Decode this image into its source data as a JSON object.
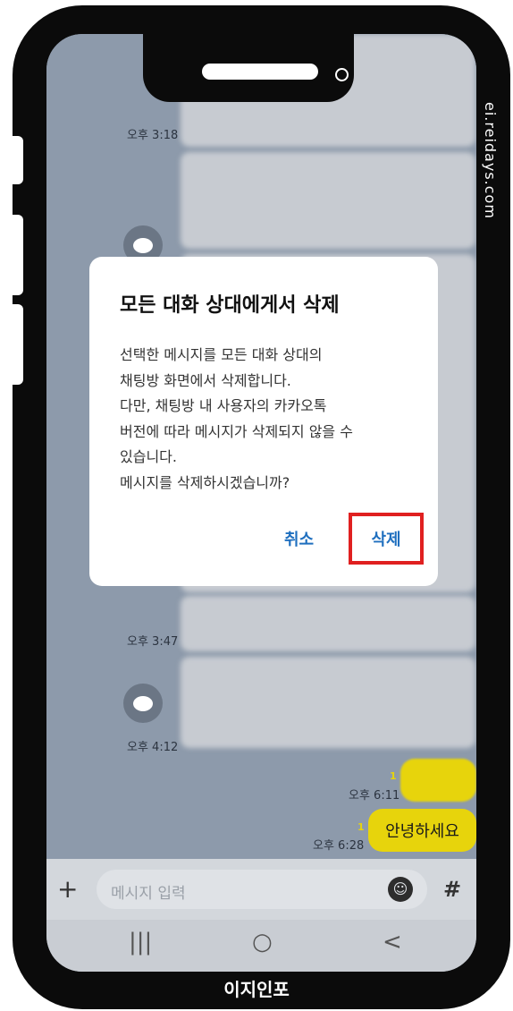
{
  "chat": {
    "timestamps": [
      "오후 3:18",
      "오후 3:47",
      "오후 4:12",
      "오후 6:11",
      "오후 6:28"
    ],
    "unread": [
      "1",
      "1"
    ],
    "sent_greeting": "안녕하세요"
  },
  "dialog": {
    "title": "모든 대화 상대에게서 삭제",
    "body_lines": [
      "선택한 메시지를 모든 대화 상대의",
      "채팅방 화면에서 삭제합니다.",
      "다만, 채팅방 내 사용자의 카카오톡",
      "버전에 따라 메시지가 삭제되지 않을 수",
      "있습니다.",
      "메시지를 삭제하시겠습니까?"
    ],
    "cancel_label": "취소",
    "delete_label": "삭제"
  },
  "input": {
    "plus": "+",
    "placeholder": "메시지 입력",
    "hash": "#"
  },
  "navbar": {
    "recent": "|||",
    "home": "○",
    "back": "<"
  },
  "watermark": "ei.reidays.com",
  "brand": "이지인포",
  "colors": {
    "accent_yellow": "#e7d40c",
    "button_blue": "#1f6fbf",
    "highlight_red": "#e02020"
  }
}
